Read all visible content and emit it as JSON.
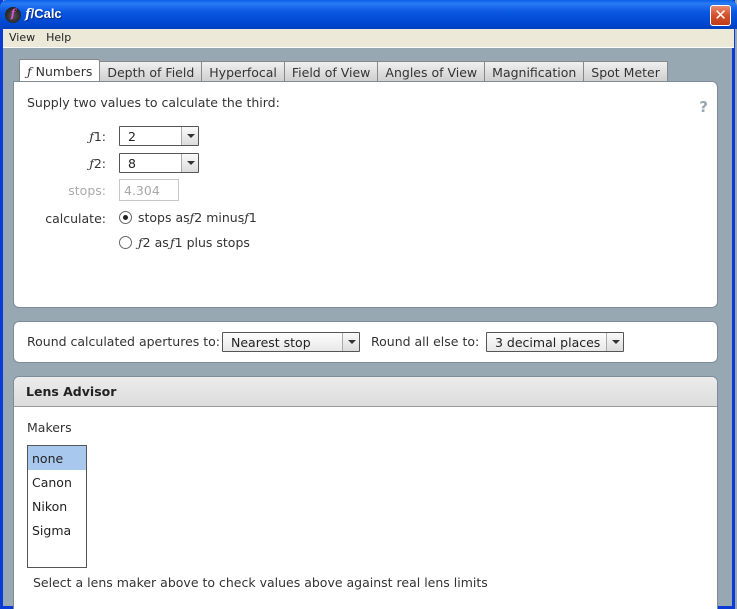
{
  "window": {
    "title_prefix": "f",
    "title_suffix": "/Calc",
    "app_icon": "fcalc-app-icon",
    "close_glyph": "✕"
  },
  "menu": [
    {
      "label": "View"
    },
    {
      "label": "Help"
    }
  ],
  "tabs": [
    {
      "prefix": "ƒ",
      "label": " Numbers",
      "active": true
    },
    {
      "label": "Depth of Field"
    },
    {
      "label": "Hyperfocal"
    },
    {
      "label": "Field of View"
    },
    {
      "label": "Angles of View"
    },
    {
      "label": "Magnification"
    },
    {
      "label": "Spot Meter"
    }
  ],
  "fnumbers": {
    "intro": "Supply two values to calculate the third:",
    "help_glyph": "?",
    "f1": {
      "label_prefix": "ƒ",
      "label_suffix": "1:",
      "value": "2"
    },
    "f2": {
      "label_prefix": "ƒ",
      "label_suffix": "2:",
      "value": "8"
    },
    "stops": {
      "label": "stops:",
      "value": "4.304",
      "disabled": true
    },
    "calculate": {
      "label": "calculate:",
      "options": [
        {
          "parts": [
            "stops as ",
            "ƒ",
            "2 minus ",
            "ƒ",
            "1"
          ],
          "selected": true
        },
        {
          "parts": [
            "",
            "ƒ",
            "2 as ",
            "ƒ",
            "1 plus stops"
          ],
          "selected": false
        }
      ]
    }
  },
  "rounding": {
    "apertures_label": "Round calculated apertures to:",
    "apertures_value": "Nearest stop",
    "else_label": "Round all else to:",
    "else_value": "3 decimal places"
  },
  "lens_advisor": {
    "title": "Lens Advisor",
    "makers_label": "Makers",
    "makers": [
      "none",
      "Canon",
      "Nikon",
      "Sigma"
    ],
    "selected_maker": "none",
    "note": "Select a lens maker above to check values above against real lens limits"
  }
}
